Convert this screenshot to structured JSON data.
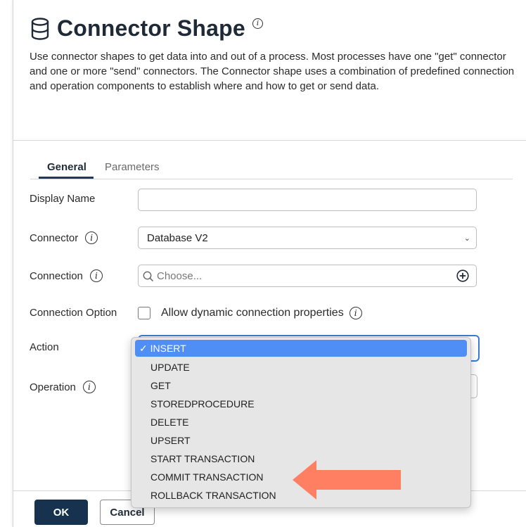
{
  "header": {
    "title": "Connector Shape",
    "description": "Use connector shapes to get data into and out of a process. Most processes have one \"get\" connector and one or more \"send\" connectors. The Connector shape uses a combination of predefined connection and operation components to establish where and how to get or send data."
  },
  "tabs": {
    "general": "General",
    "parameters": "Parameters"
  },
  "form": {
    "display_name_label": "Display Name",
    "display_name_value": "",
    "connector_label": "Connector",
    "connector_value": "Database V2",
    "connection_label": "Connection",
    "connection_placeholder": "Choose...",
    "connection_option_label": "Connection Option",
    "connection_option_checkbox_label": "Allow dynamic connection properties",
    "action_label": "Action",
    "operation_label": "Operation"
  },
  "action_dropdown": {
    "selected_mark": "✓",
    "options": [
      "INSERT",
      "UPDATE",
      "GET",
      "STOREDPROCEDURE",
      "DELETE",
      "UPSERT",
      "START TRANSACTION",
      "COMMIT TRANSACTION",
      "ROLLBACK TRANSACTION"
    ],
    "selected_index": 0
  },
  "footer": {
    "ok_label": "OK",
    "cancel_label": "Cancel"
  },
  "icons": {
    "title_icon": "database-icon",
    "info_icon": "info-icon",
    "search_icon": "search-icon",
    "add_icon": "plus-circle-icon",
    "chevron_icon": "chevron-down-icon",
    "annotation": "arrow-left-icon"
  },
  "colors": {
    "primary_button": "#16324f",
    "selected_option": "#4f8ef5",
    "annotation_arrow": "#ff7f63",
    "focus_border": "#3a7bd5"
  }
}
